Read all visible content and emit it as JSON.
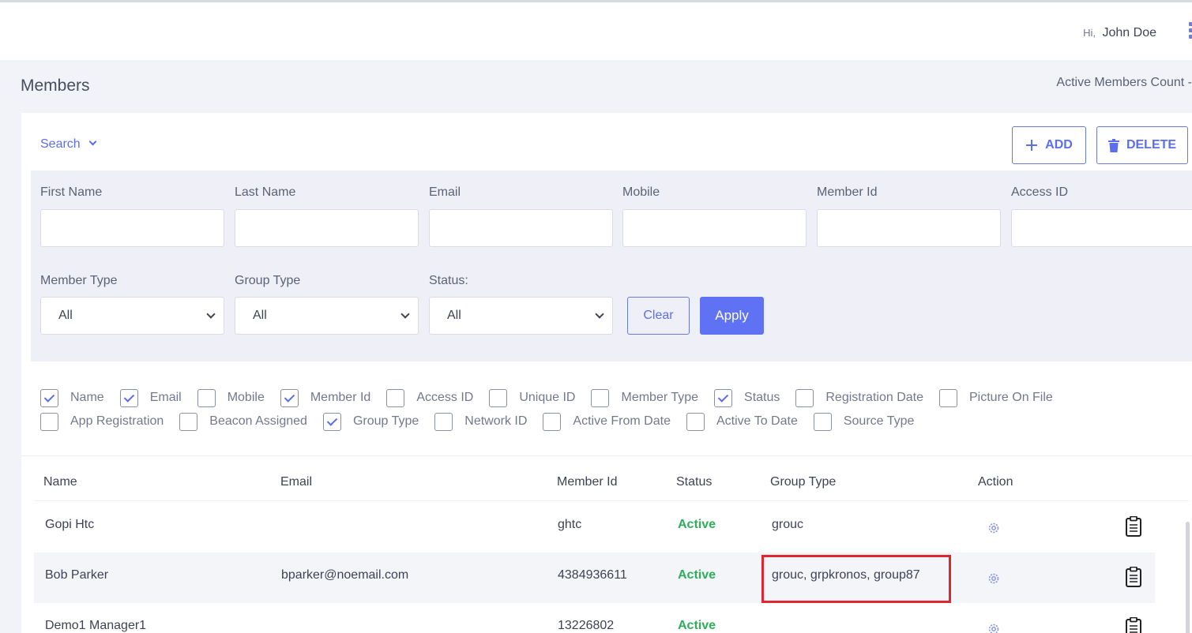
{
  "header": {
    "greeting": "Hi,",
    "user_name": "John Doe"
  },
  "page": {
    "title": "Members",
    "active_count_label": "Active Members Count -"
  },
  "toolbar": {
    "search_label": "Search",
    "add_label": "ADD",
    "delete_label": "DELETE"
  },
  "filters": {
    "first_name": {
      "label": "First Name",
      "value": ""
    },
    "last_name": {
      "label": "Last Name",
      "value": ""
    },
    "email": {
      "label": "Email",
      "value": ""
    },
    "mobile": {
      "label": "Mobile",
      "value": ""
    },
    "member_id": {
      "label": "Member Id",
      "value": ""
    },
    "access_id": {
      "label": "Access ID",
      "value": ""
    },
    "member_type": {
      "label": "Member Type",
      "value": "All"
    },
    "group_type": {
      "label": "Group Type",
      "value": "All"
    },
    "status": {
      "label": "Status:",
      "value": "All"
    },
    "clear_label": "Clear",
    "apply_label": "Apply"
  },
  "columns": [
    {
      "label": "Name",
      "checked": true
    },
    {
      "label": "Email",
      "checked": true
    },
    {
      "label": "Mobile",
      "checked": false
    },
    {
      "label": "Member Id",
      "checked": true
    },
    {
      "label": "Access ID",
      "checked": false
    },
    {
      "label": "Unique ID",
      "checked": false
    },
    {
      "label": "Member Type",
      "checked": false
    },
    {
      "label": "Status",
      "checked": true
    },
    {
      "label": "Registration Date",
      "checked": false
    },
    {
      "label": "Picture On File",
      "checked": false
    },
    {
      "label": "App Registration",
      "checked": false
    },
    {
      "label": "Beacon Assigned",
      "checked": false
    },
    {
      "label": "Group Type",
      "checked": true
    },
    {
      "label": "Network ID",
      "checked": false
    },
    {
      "label": "Active From Date",
      "checked": false
    },
    {
      "label": "Active To Date",
      "checked": false
    },
    {
      "label": "Source Type",
      "checked": false
    }
  ],
  "table": {
    "headers": [
      "Name",
      "Email",
      "Member Id",
      "Status",
      "Group Type",
      "Action"
    ],
    "rows": [
      {
        "name": "Gopi Htc",
        "email": "",
        "member_id": "ghtc",
        "status": "Active",
        "group_type": "grouc"
      },
      {
        "name": "Bob Parker",
        "email": "bparker@noemail.com",
        "member_id": "4384936611",
        "status": "Active",
        "group_type": "grouc, grpkronos, group87"
      },
      {
        "name": "Demo1 Manager1",
        "email": "",
        "member_id": "13226802",
        "status": "Active",
        "group_type": ""
      }
    ]
  },
  "icons": {
    "action_settings": "gear-icon",
    "action_details": "clipboard-icon",
    "add": "plus-icon",
    "delete": "trash-icon"
  },
  "colors": {
    "accent": "#5e72f3",
    "status_active": "#2eae5a",
    "highlight": "#e0262f"
  }
}
